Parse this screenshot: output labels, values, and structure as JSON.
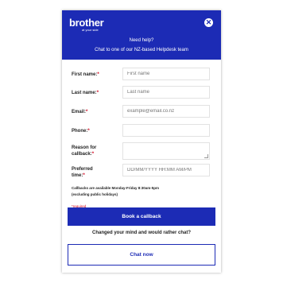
{
  "header": {
    "logo_word": "brother",
    "logo_tagline": "at your side",
    "close_glyph": "✕",
    "title": "Need help?",
    "subtitle": "Chat to one of our NZ-based Helpdesk team"
  },
  "form": {
    "first_name": {
      "label": "First name:",
      "required_mark": "*",
      "placeholder": "First name",
      "value": ""
    },
    "last_name": {
      "label": "Last name:",
      "required_mark": "*",
      "placeholder": "Last name",
      "value": ""
    },
    "email": {
      "label": "Email:",
      "required_mark": "*",
      "placeholder": "example@email.co.nz",
      "value": ""
    },
    "phone": {
      "label": "Phone:",
      "required_mark": "*",
      "placeholder": "",
      "value": ""
    },
    "reason": {
      "label_line1": "Reason for",
      "label_line2": "callback:",
      "required_mark": "*",
      "placeholder": "",
      "value": ""
    },
    "preferred_time": {
      "label_line1": "Preferred",
      "label_line2": "time:",
      "required_mark": "*",
      "placeholder": "DD/MM/YYYY HH:MM AM/PM",
      "value": ""
    },
    "availability_line1": "Callbacks are available Monday-Friday 8:30am-5pm",
    "availability_line2": "(excluding public holidays)",
    "required_note": "*required"
  },
  "actions": {
    "book_label": "Book a callback",
    "changed_mind": "Changed your mind and would rather chat?",
    "chat_label": "Chat now"
  },
  "colors": {
    "brand_blue": "#1c2bb5",
    "required_red": "#d0021b"
  },
  "icons": [
    "close-icon",
    "resize-handle-icon"
  ]
}
